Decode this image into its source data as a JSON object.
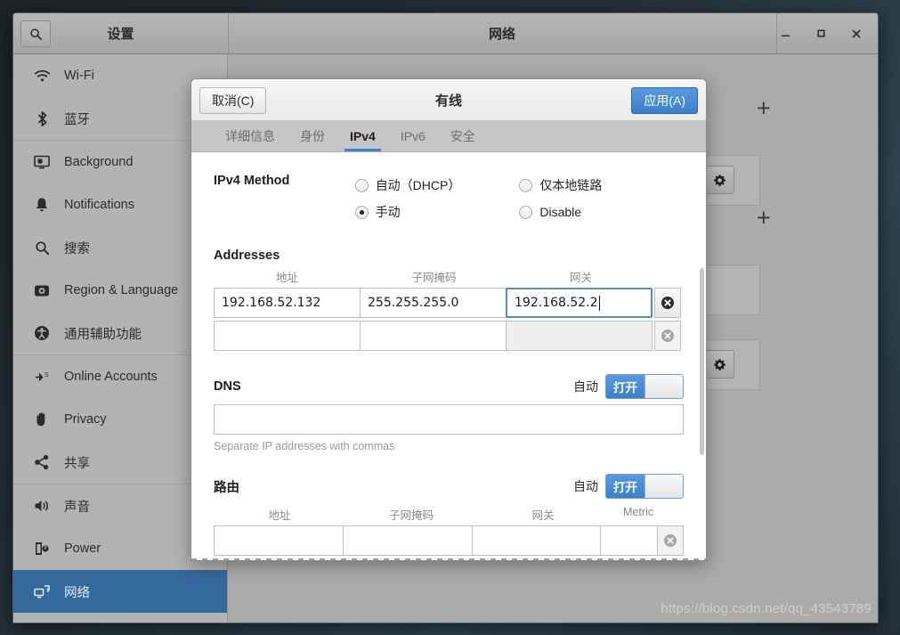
{
  "settings_window": {
    "left_title": "设置",
    "right_title": "网络",
    "search_icon": "search-icon",
    "window_controls": {
      "minimize": "–",
      "maximize": "□",
      "close": "✕"
    }
  },
  "sidebar": {
    "items": [
      {
        "label": "Wi-Fi",
        "icon": "wifi-icon",
        "selected": false
      },
      {
        "label": "蓝牙",
        "icon": "bluetooth-icon",
        "selected": false
      },
      {
        "label": "Background",
        "icon": "monitor-icon",
        "selected": false
      },
      {
        "label": "Notifications",
        "icon": "bell-icon",
        "selected": false
      },
      {
        "label": "搜索",
        "icon": "search-icon",
        "selected": false
      },
      {
        "label": "Region & Language",
        "icon": "globe-icon",
        "selected": false
      },
      {
        "label": "通用辅助功能",
        "icon": "accessibility-icon",
        "selected": false
      },
      {
        "label": "Online Accounts",
        "icon": "online-accounts-icon",
        "selected": false
      },
      {
        "label": "Privacy",
        "icon": "hand-icon",
        "selected": false
      },
      {
        "label": "共享",
        "icon": "share-icon",
        "selected": false
      },
      {
        "label": "声音",
        "icon": "speaker-icon",
        "selected": false
      },
      {
        "label": "Power",
        "icon": "power-icon",
        "selected": false
      },
      {
        "label": "网络",
        "icon": "network-icon",
        "selected": true
      }
    ]
  },
  "background_panel": {
    "add_button_1": "+",
    "add_button_2": "+",
    "gear_button_1": "gear-icon",
    "gear_button_2": "gear-icon"
  },
  "dialog": {
    "title": "有线",
    "cancel_label": "取消(C)",
    "apply_label": "应用(A)",
    "accent_color": "#3b7fcc",
    "tabs": [
      {
        "label": "详细信息",
        "active": false
      },
      {
        "label": "身份",
        "active": false
      },
      {
        "label": "IPv4",
        "active": true
      },
      {
        "label": "IPv6",
        "active": false
      },
      {
        "label": "安全",
        "active": false
      }
    ],
    "method": {
      "label": "IPv4 Method",
      "options": [
        {
          "label": "自动（DHCP）",
          "checked": false
        },
        {
          "label": "手动",
          "checked": true
        },
        {
          "label": "仅本地链路",
          "checked": false
        },
        {
          "label": "Disable",
          "checked": false
        }
      ]
    },
    "addresses": {
      "title": "Addresses",
      "columns": [
        "地址",
        "子网掩码",
        "网关"
      ],
      "rows": [
        {
          "address": "192.168.52.132",
          "netmask": "255.255.255.0",
          "gateway": "192.168.52.2",
          "focused_field": "gateway",
          "delete_enabled": true
        },
        {
          "address": "",
          "netmask": "",
          "gateway": "",
          "focused_field": "",
          "delete_enabled": false
        }
      ]
    },
    "dns": {
      "title": "DNS",
      "auto_label": "自动",
      "toggle_state": "打开",
      "value": "",
      "hint": "Separate IP addresses with commas"
    },
    "routes": {
      "title": "路由",
      "auto_label": "自动",
      "toggle_state": "打开",
      "columns": [
        "地址",
        "子网掩码",
        "网关",
        "Metric"
      ],
      "rows": [
        {
          "address": "",
          "netmask": "",
          "gateway": "",
          "metric": ""
        }
      ]
    }
  },
  "watermark": "https://blog.csdn.net/qq_43543789"
}
